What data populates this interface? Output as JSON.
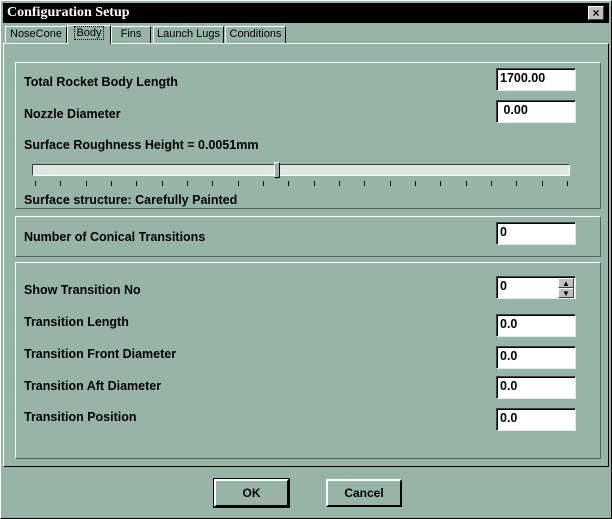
{
  "window": {
    "title": "Configuration Setup",
    "close_glyph": "×"
  },
  "tabs": [
    {
      "label": "NoseCone"
    },
    {
      "label": "Body"
    },
    {
      "label": "Fins"
    },
    {
      "label": "Launch Lugs"
    },
    {
      "label": "Conditions"
    }
  ],
  "active_tab": "Body",
  "body_group": {
    "length_label": "Total Rocket Body Length",
    "length_value": "1700.00",
    "nozzle_label": "Nozzle Diameter",
    "nozzle_value": " 0.00",
    "roughness_label": "Surface Roughness Height = 0.0051mm",
    "roughness_slider_position": 0.455,
    "structure_label": "Surface structure: Carefully Painted"
  },
  "conical": {
    "label": "Number of Conical Transitions",
    "value": "0"
  },
  "transition": {
    "show_label": "Show Transition No",
    "show_value": "0",
    "length_label": "Transition Length",
    "length_value": "0.0",
    "front_label": "Transition Front Diameter",
    "front_value": "0.0",
    "aft_label": "Transition Aft Diameter",
    "aft_value": "0.0",
    "position_label": "Transition Position",
    "position_value": "0.0",
    "spin_up_glyph": "▲",
    "spin_down_glyph": "▼"
  },
  "buttons": {
    "ok": "OK",
    "cancel": "Cancel"
  },
  "colors": {
    "dialog_bg": "#98b4a8",
    "titlebar": "#000000",
    "field_bg": "#ffffff"
  }
}
